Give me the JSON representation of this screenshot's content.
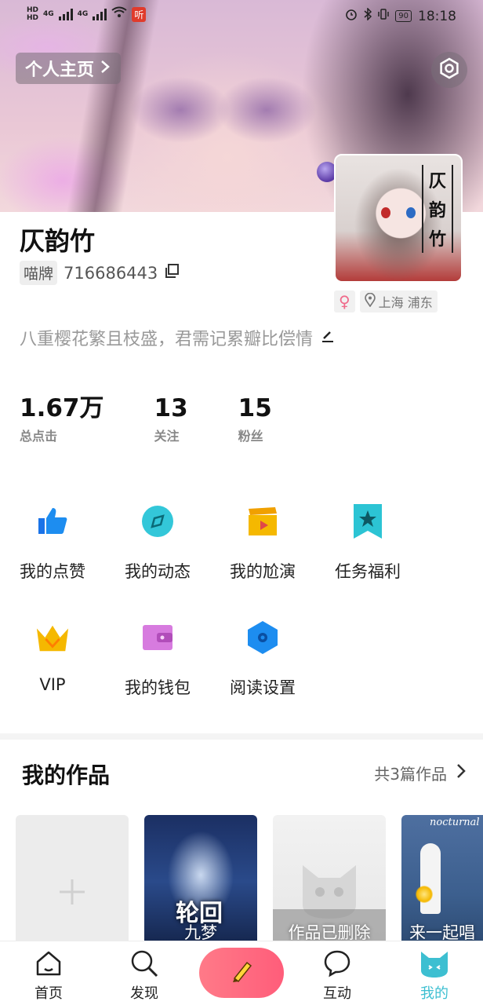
{
  "status_bar": {
    "carrier_text": "4G",
    "carrier_text2": "4G",
    "listen_badge": "听",
    "battery": "90",
    "time": "18:18"
  },
  "header": {
    "home_button_label": "个人主页",
    "settings_icon": "gear-hexagon-icon"
  },
  "profile": {
    "name": "仄韵竹",
    "id_tag": "喵牌",
    "id_number": "716686443",
    "avatar_calligraphy": [
      "仄",
      "韵",
      "竹"
    ],
    "gender_symbol": "♀",
    "location": "上海 浦东",
    "signature": "八重樱花繁且枝盛，君需记累瓣比偿情"
  },
  "stats": [
    {
      "value": "1.67万",
      "label": "总点击"
    },
    {
      "value": "13",
      "label": "关注"
    },
    {
      "value": "15",
      "label": "粉丝"
    }
  ],
  "menu": [
    {
      "label": "我的点赞",
      "icon": "thumbs-up-icon",
      "color": "#1d8df0"
    },
    {
      "label": "我的动态",
      "icon": "compass-icon",
      "color": "#33c7d9"
    },
    {
      "label": "我的尬演",
      "icon": "clapperboard-icon",
      "color": "#f5b800"
    },
    {
      "label": "任务福利",
      "icon": "star-bookmark-icon",
      "color": "#2cc4d4"
    },
    {
      "label": "VIP",
      "icon": "crown-icon",
      "color": "#f5b800"
    },
    {
      "label": "我的钱包",
      "icon": "wallet-icon",
      "color": "#d77bdf"
    },
    {
      "label": "阅读设置",
      "icon": "hexagon-settings-icon",
      "color": "#1d8df0"
    }
  ],
  "works": {
    "title": "我的作品",
    "count_label": "共3篇作品",
    "items": [
      {
        "caption": "",
        "type": "add"
      },
      {
        "caption": "九梦",
        "cover_title": "轮回",
        "type": "cover"
      },
      {
        "caption": "作品已删除",
        "type": "deleted"
      },
      {
        "caption": "来一起唱",
        "cover_title": "nocturnal",
        "type": "cover"
      }
    ]
  },
  "nav": {
    "items": [
      {
        "label": "首页",
        "icon": "home-icon"
      },
      {
        "label": "发现",
        "icon": "search-icon"
      },
      {
        "label": "",
        "icon": "pencil-icon"
      },
      {
        "label": "互动",
        "icon": "chat-bubble-icon"
      },
      {
        "label": "我的",
        "icon": "cat-face-icon"
      }
    ],
    "active": "我的",
    "accent": "#3dbfd1"
  }
}
